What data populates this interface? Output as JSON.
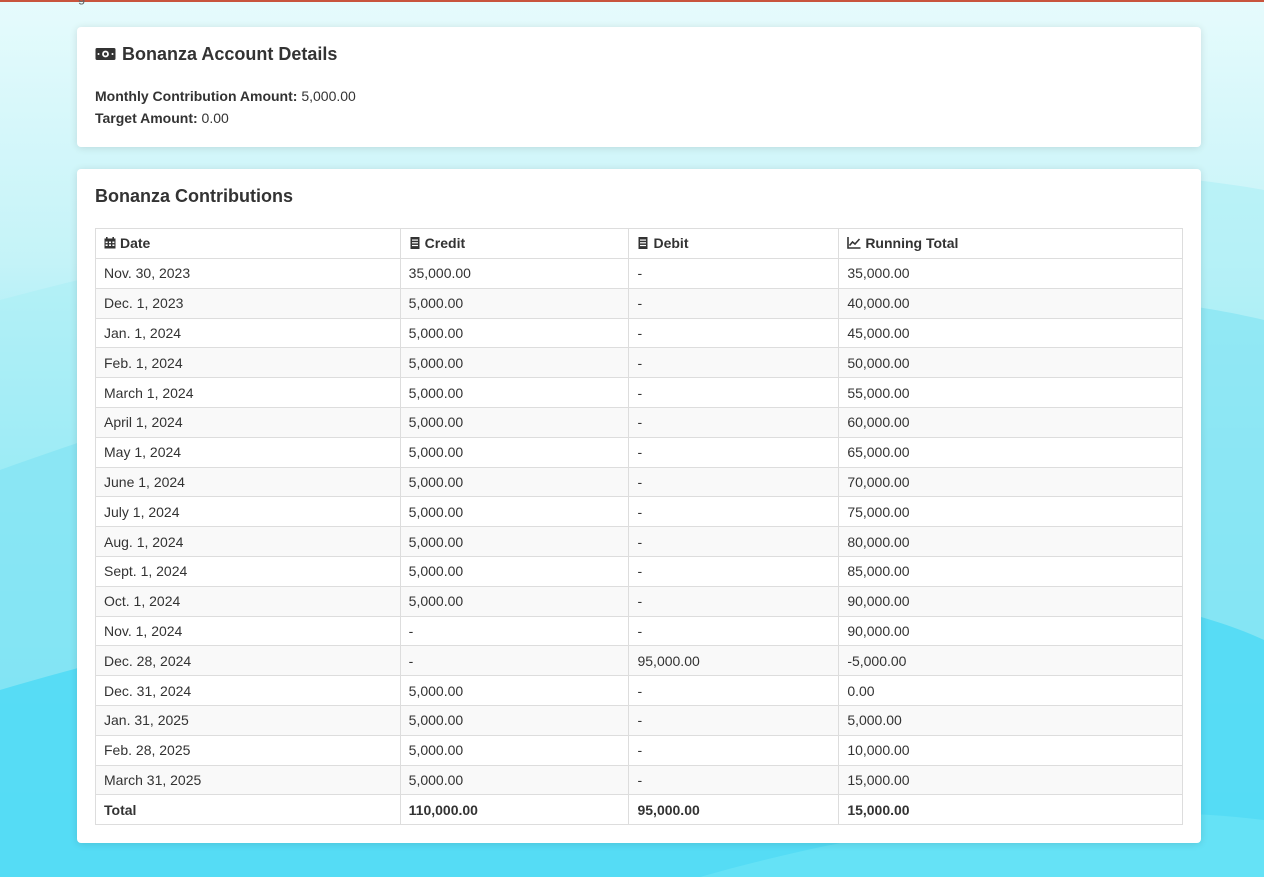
{
  "top_fragment": "g",
  "details": {
    "title": "Bonanza Account Details",
    "icon": "money-icon",
    "monthly_label": "Monthly Contribution Amount:",
    "monthly_value": "5,000.00",
    "target_label": "Target Amount:",
    "target_value": "0.00"
  },
  "contributions": {
    "title": "Bonanza Contributions",
    "headers": {
      "date": "Date",
      "credit": "Credit",
      "debit": "Debit",
      "running_total": "Running Total"
    },
    "header_icons": {
      "date": "calendar-icon",
      "credit": "receipt-icon",
      "debit": "receipt-icon",
      "running_total": "line-chart-icon"
    },
    "rows": [
      {
        "date": "Nov. 30, 2023",
        "credit": "35,000.00",
        "debit": "-",
        "total": "35,000.00"
      },
      {
        "date": "Dec. 1, 2023",
        "credit": "5,000.00",
        "debit": "-",
        "total": "40,000.00"
      },
      {
        "date": "Jan. 1, 2024",
        "credit": "5,000.00",
        "debit": "-",
        "total": "45,000.00"
      },
      {
        "date": "Feb. 1, 2024",
        "credit": "5,000.00",
        "debit": "-",
        "total": "50,000.00"
      },
      {
        "date": "March 1, 2024",
        "credit": "5,000.00",
        "debit": "-",
        "total": "55,000.00"
      },
      {
        "date": "April 1, 2024",
        "credit": "5,000.00",
        "debit": "-",
        "total": "60,000.00"
      },
      {
        "date": "May 1, 2024",
        "credit": "5,000.00",
        "debit": "-",
        "total": "65,000.00"
      },
      {
        "date": "June 1, 2024",
        "credit": "5,000.00",
        "debit": "-",
        "total": "70,000.00"
      },
      {
        "date": "July 1, 2024",
        "credit": "5,000.00",
        "debit": "-",
        "total": "75,000.00"
      },
      {
        "date": "Aug. 1, 2024",
        "credit": "5,000.00",
        "debit": "-",
        "total": "80,000.00"
      },
      {
        "date": "Sept. 1, 2024",
        "credit": "5,000.00",
        "debit": "-",
        "total": "85,000.00"
      },
      {
        "date": "Oct. 1, 2024",
        "credit": "5,000.00",
        "debit": "-",
        "total": "90,000.00"
      },
      {
        "date": "Nov. 1, 2024",
        "credit": "-",
        "debit": "-",
        "total": "90,000.00"
      },
      {
        "date": "Dec. 28, 2024",
        "credit": "-",
        "debit": "95,000.00",
        "total": "-5,000.00"
      },
      {
        "date": "Dec. 31, 2024",
        "credit": "5,000.00",
        "debit": "-",
        "total": "0.00"
      },
      {
        "date": "Jan. 31, 2025",
        "credit": "5,000.00",
        "debit": "-",
        "total": "5,000.00"
      },
      {
        "date": "Feb. 28, 2025",
        "credit": "5,000.00",
        "debit": "-",
        "total": "10,000.00"
      },
      {
        "date": "March 31, 2025",
        "credit": "5,000.00",
        "debit": "-",
        "total": "15,000.00"
      }
    ],
    "footer": {
      "label": "Total",
      "credit": "110,000.00",
      "debit": "95,000.00",
      "total": "15,000.00"
    }
  },
  "colors": {
    "accent_line": "#c8553d",
    "background_top": "#e6fbfc",
    "background_bottom": "#3bd6f3"
  }
}
